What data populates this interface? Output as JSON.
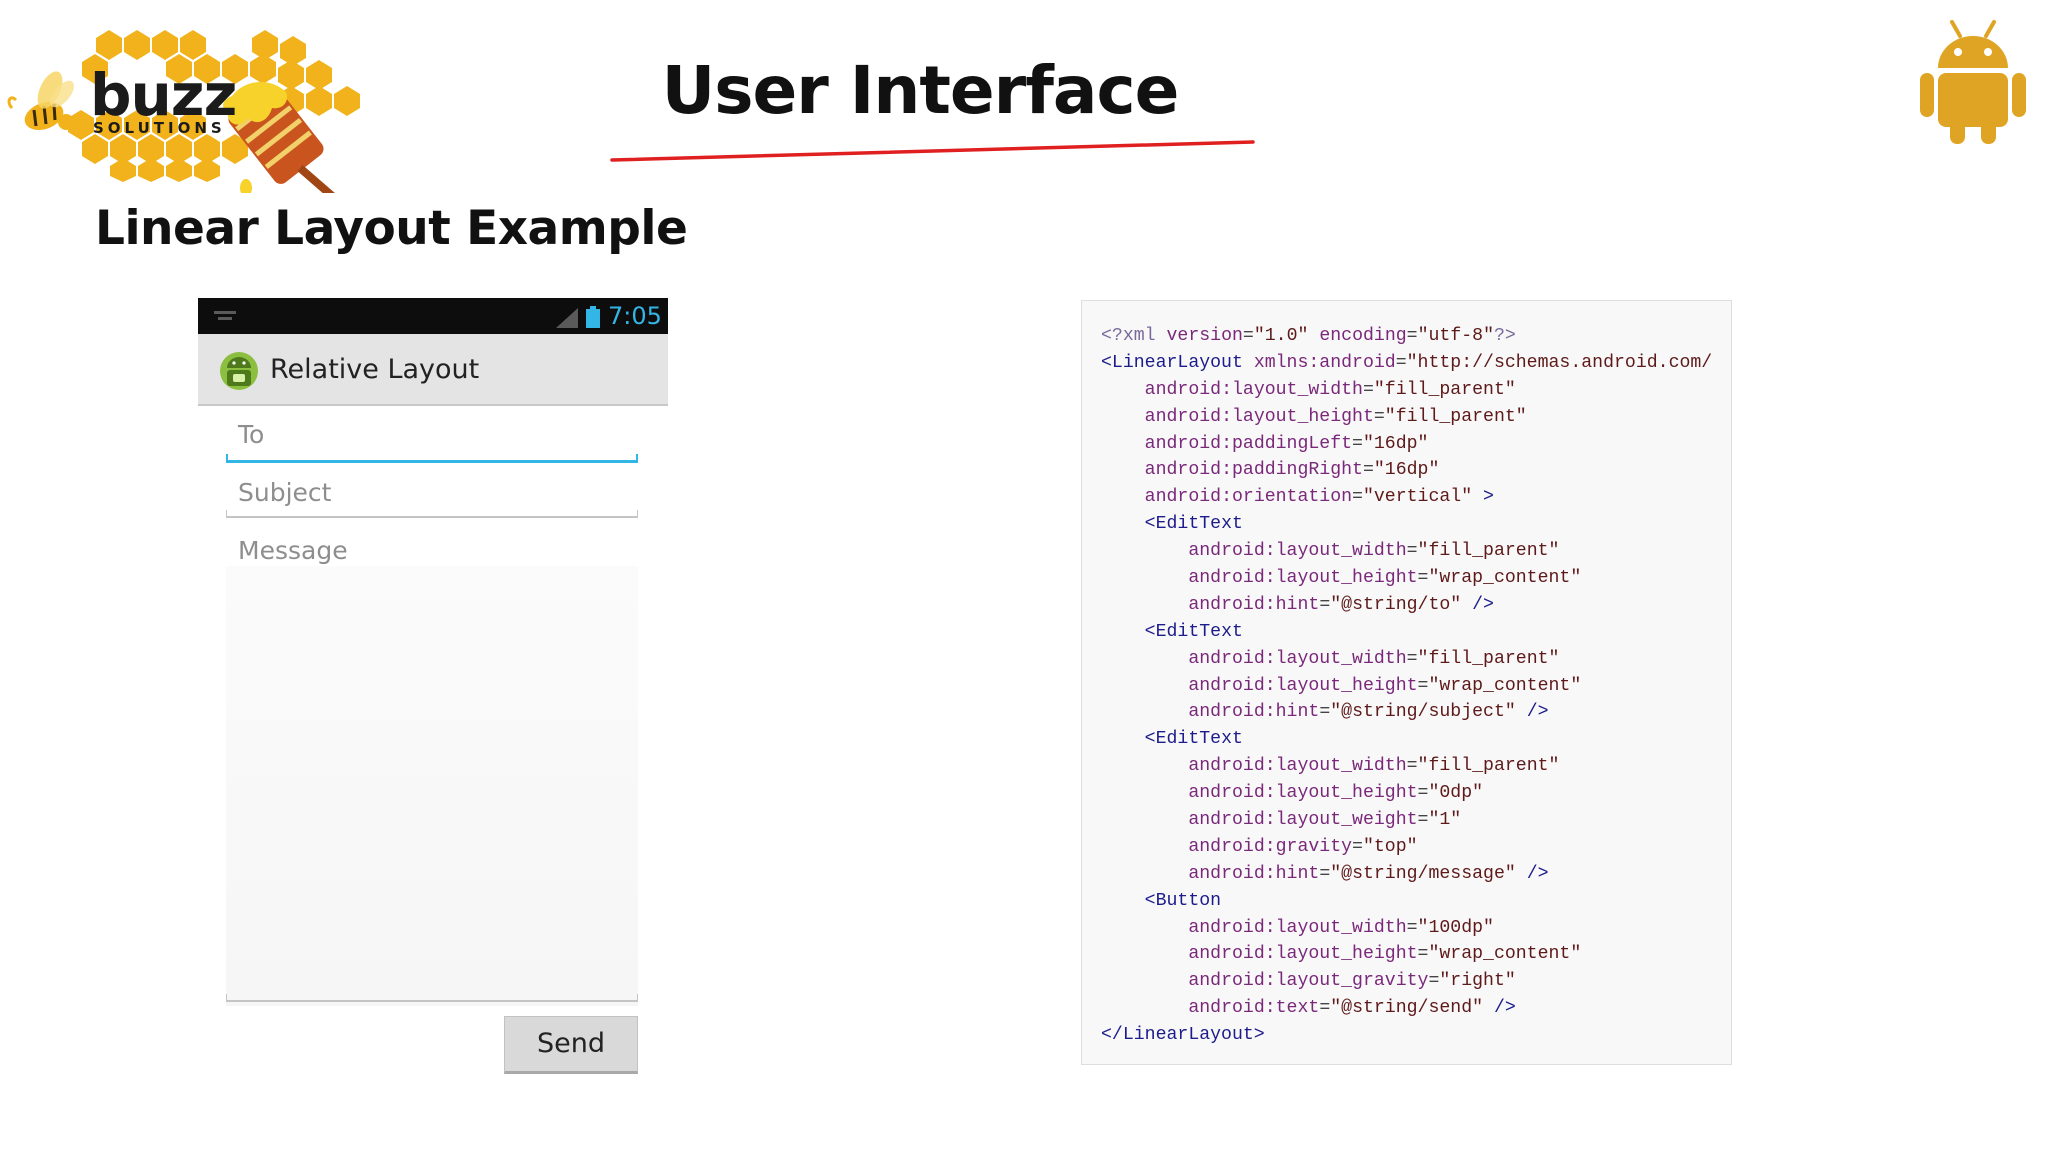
{
  "logo": {
    "word": "buzz",
    "sub": "SOLUTIONS"
  },
  "slide": {
    "title": "User Interface",
    "subtitle": "Linear Layout Example"
  },
  "phone": {
    "status_time": "7:05",
    "app_title": "Relative Layout",
    "to_hint": "To",
    "subject_hint": "Subject",
    "message_hint": "Message",
    "send_label": "Send"
  },
  "code": [
    {
      "indent": 0,
      "tokens": [
        [
          "pi",
          "<?xml "
        ],
        [
          "attr",
          "version"
        ],
        [
          "op",
          "="
        ],
        [
          "val",
          "\"1.0\""
        ],
        [
          "op",
          " "
        ],
        [
          "attr",
          "encoding"
        ],
        [
          "op",
          "="
        ],
        [
          "val",
          "\"utf-8\""
        ],
        [
          "pi",
          "?>"
        ]
      ]
    },
    {
      "indent": 0,
      "tokens": [
        [
          "tag",
          "<LinearLayout "
        ],
        [
          "attr",
          "xmlns:android"
        ],
        [
          "op",
          "="
        ],
        [
          "val",
          "\"http://schemas.android.com/"
        ]
      ]
    },
    {
      "indent": 1,
      "tokens": [
        [
          "attr",
          "android:layout_width"
        ],
        [
          "op",
          "="
        ],
        [
          "val",
          "\"fill_parent\""
        ]
      ]
    },
    {
      "indent": 1,
      "tokens": [
        [
          "attr",
          "android:layout_height"
        ],
        [
          "op",
          "="
        ],
        [
          "val",
          "\"fill_parent\""
        ]
      ]
    },
    {
      "indent": 1,
      "tokens": [
        [
          "attr",
          "android:paddingLeft"
        ],
        [
          "op",
          "="
        ],
        [
          "val",
          "\"16dp\""
        ]
      ]
    },
    {
      "indent": 1,
      "tokens": [
        [
          "attr",
          "android:paddingRight"
        ],
        [
          "op",
          "="
        ],
        [
          "val",
          "\"16dp\""
        ]
      ]
    },
    {
      "indent": 1,
      "tokens": [
        [
          "attr",
          "android:orientation"
        ],
        [
          "op",
          "="
        ],
        [
          "val",
          "\"vertical\""
        ],
        [
          "punct",
          " >"
        ]
      ]
    },
    {
      "indent": 1,
      "tokens": [
        [
          "tag",
          "<EditText"
        ]
      ]
    },
    {
      "indent": 2,
      "tokens": [
        [
          "attr",
          "android:layout_width"
        ],
        [
          "op",
          "="
        ],
        [
          "val",
          "\"fill_parent\""
        ]
      ]
    },
    {
      "indent": 2,
      "tokens": [
        [
          "attr",
          "android:layout_height"
        ],
        [
          "op",
          "="
        ],
        [
          "val",
          "\"wrap_content\""
        ]
      ]
    },
    {
      "indent": 2,
      "tokens": [
        [
          "attr",
          "android:hint"
        ],
        [
          "op",
          "="
        ],
        [
          "val",
          "\"@string/to\""
        ],
        [
          "punct",
          " />"
        ]
      ]
    },
    {
      "indent": 1,
      "tokens": [
        [
          "tag",
          "<EditText"
        ]
      ]
    },
    {
      "indent": 2,
      "tokens": [
        [
          "attr",
          "android:layout_width"
        ],
        [
          "op",
          "="
        ],
        [
          "val",
          "\"fill_parent\""
        ]
      ]
    },
    {
      "indent": 2,
      "tokens": [
        [
          "attr",
          "android:layout_height"
        ],
        [
          "op",
          "="
        ],
        [
          "val",
          "\"wrap_content\""
        ]
      ]
    },
    {
      "indent": 2,
      "tokens": [
        [
          "attr",
          "android:hint"
        ],
        [
          "op",
          "="
        ],
        [
          "val",
          "\"@string/subject\""
        ],
        [
          "punct",
          " />"
        ]
      ]
    },
    {
      "indent": 1,
      "tokens": [
        [
          "tag",
          "<EditText"
        ]
      ]
    },
    {
      "indent": 2,
      "tokens": [
        [
          "attr",
          "android:layout_width"
        ],
        [
          "op",
          "="
        ],
        [
          "val",
          "\"fill_parent\""
        ]
      ]
    },
    {
      "indent": 2,
      "tokens": [
        [
          "attr",
          "android:layout_height"
        ],
        [
          "op",
          "="
        ],
        [
          "val",
          "\"0dp\""
        ]
      ]
    },
    {
      "indent": 2,
      "tokens": [
        [
          "attr",
          "android:layout_weight"
        ],
        [
          "op",
          "="
        ],
        [
          "val",
          "\"1\""
        ]
      ]
    },
    {
      "indent": 2,
      "tokens": [
        [
          "attr",
          "android:gravity"
        ],
        [
          "op",
          "="
        ],
        [
          "val",
          "\"top\""
        ]
      ]
    },
    {
      "indent": 2,
      "tokens": [
        [
          "attr",
          "android:hint"
        ],
        [
          "op",
          "="
        ],
        [
          "val",
          "\"@string/message\""
        ],
        [
          "punct",
          " />"
        ]
      ]
    },
    {
      "indent": 1,
      "tokens": [
        [
          "tag",
          "<Button"
        ]
      ]
    },
    {
      "indent": 2,
      "tokens": [
        [
          "attr",
          "android:layout_width"
        ],
        [
          "op",
          "="
        ],
        [
          "val",
          "\"100dp\""
        ]
      ]
    },
    {
      "indent": 2,
      "tokens": [
        [
          "attr",
          "android:layout_height"
        ],
        [
          "op",
          "="
        ],
        [
          "val",
          "\"wrap_content\""
        ]
      ]
    },
    {
      "indent": 2,
      "tokens": [
        [
          "attr",
          "android:layout_gravity"
        ],
        [
          "op",
          "="
        ],
        [
          "val",
          "\"right\""
        ]
      ]
    },
    {
      "indent": 2,
      "tokens": [
        [
          "attr",
          "android:text"
        ],
        [
          "op",
          "="
        ],
        [
          "val",
          "\"@string/send\""
        ],
        [
          "punct",
          " />"
        ]
      ]
    },
    {
      "indent": 0,
      "tokens": [
        [
          "tag",
          "</LinearLayout>"
        ]
      ]
    }
  ],
  "colors": {
    "accent_underline": "#e02020",
    "android_gold": "#e0a424",
    "holo_blue": "#33b5e5",
    "honey": "#f2b21b"
  },
  "icons": [
    "bee-icon",
    "honeycomb-icon",
    "android-logo-icon",
    "signal-icon",
    "battery-icon",
    "app-android-icon"
  ]
}
